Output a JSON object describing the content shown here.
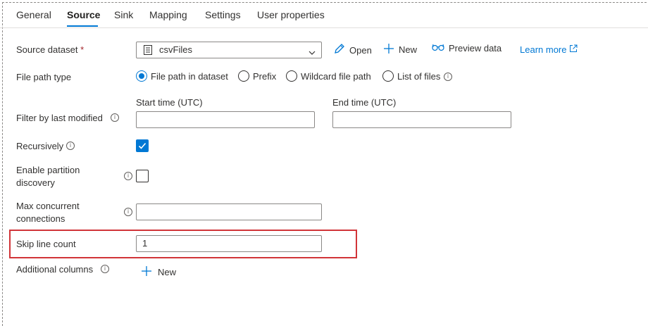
{
  "tabs": [
    "General",
    "Source",
    "Sink",
    "Mapping",
    "Settings",
    "User properties"
  ],
  "active_tab": "Source",
  "source_dataset": {
    "label": "Source dataset",
    "required_mark": "*",
    "value": "csvFiles",
    "open_label": "Open",
    "new_label": "New",
    "preview_label": "Preview data",
    "learn_more_label": "Learn more"
  },
  "file_path_type": {
    "label": "File path type",
    "options": [
      "File path in dataset",
      "Prefix",
      "Wildcard file path",
      "List of files"
    ],
    "selected": "File path in dataset"
  },
  "filter_last_modified": {
    "label": "Filter by last modified",
    "start_label": "Start time (UTC)",
    "end_label": "End time (UTC)",
    "start_value": "",
    "end_value": ""
  },
  "recursively": {
    "label": "Recursively",
    "checked": true
  },
  "partition_discovery": {
    "label": "Enable partition discovery",
    "checked": false
  },
  "max_concurrent": {
    "label": "Max concurrent connections",
    "value": ""
  },
  "skip_line_count": {
    "label": "Skip line count",
    "value": "1"
  },
  "additional_columns": {
    "label": "Additional columns",
    "new_label": "New"
  },
  "colors": {
    "accent": "#0078d4",
    "highlight": "#d13438"
  },
  "icons": [
    "file-icon",
    "chevron-down-icon",
    "pencil-icon",
    "plus-icon",
    "glasses-icon",
    "external-link-icon",
    "info-icon",
    "checkmark-icon"
  ]
}
